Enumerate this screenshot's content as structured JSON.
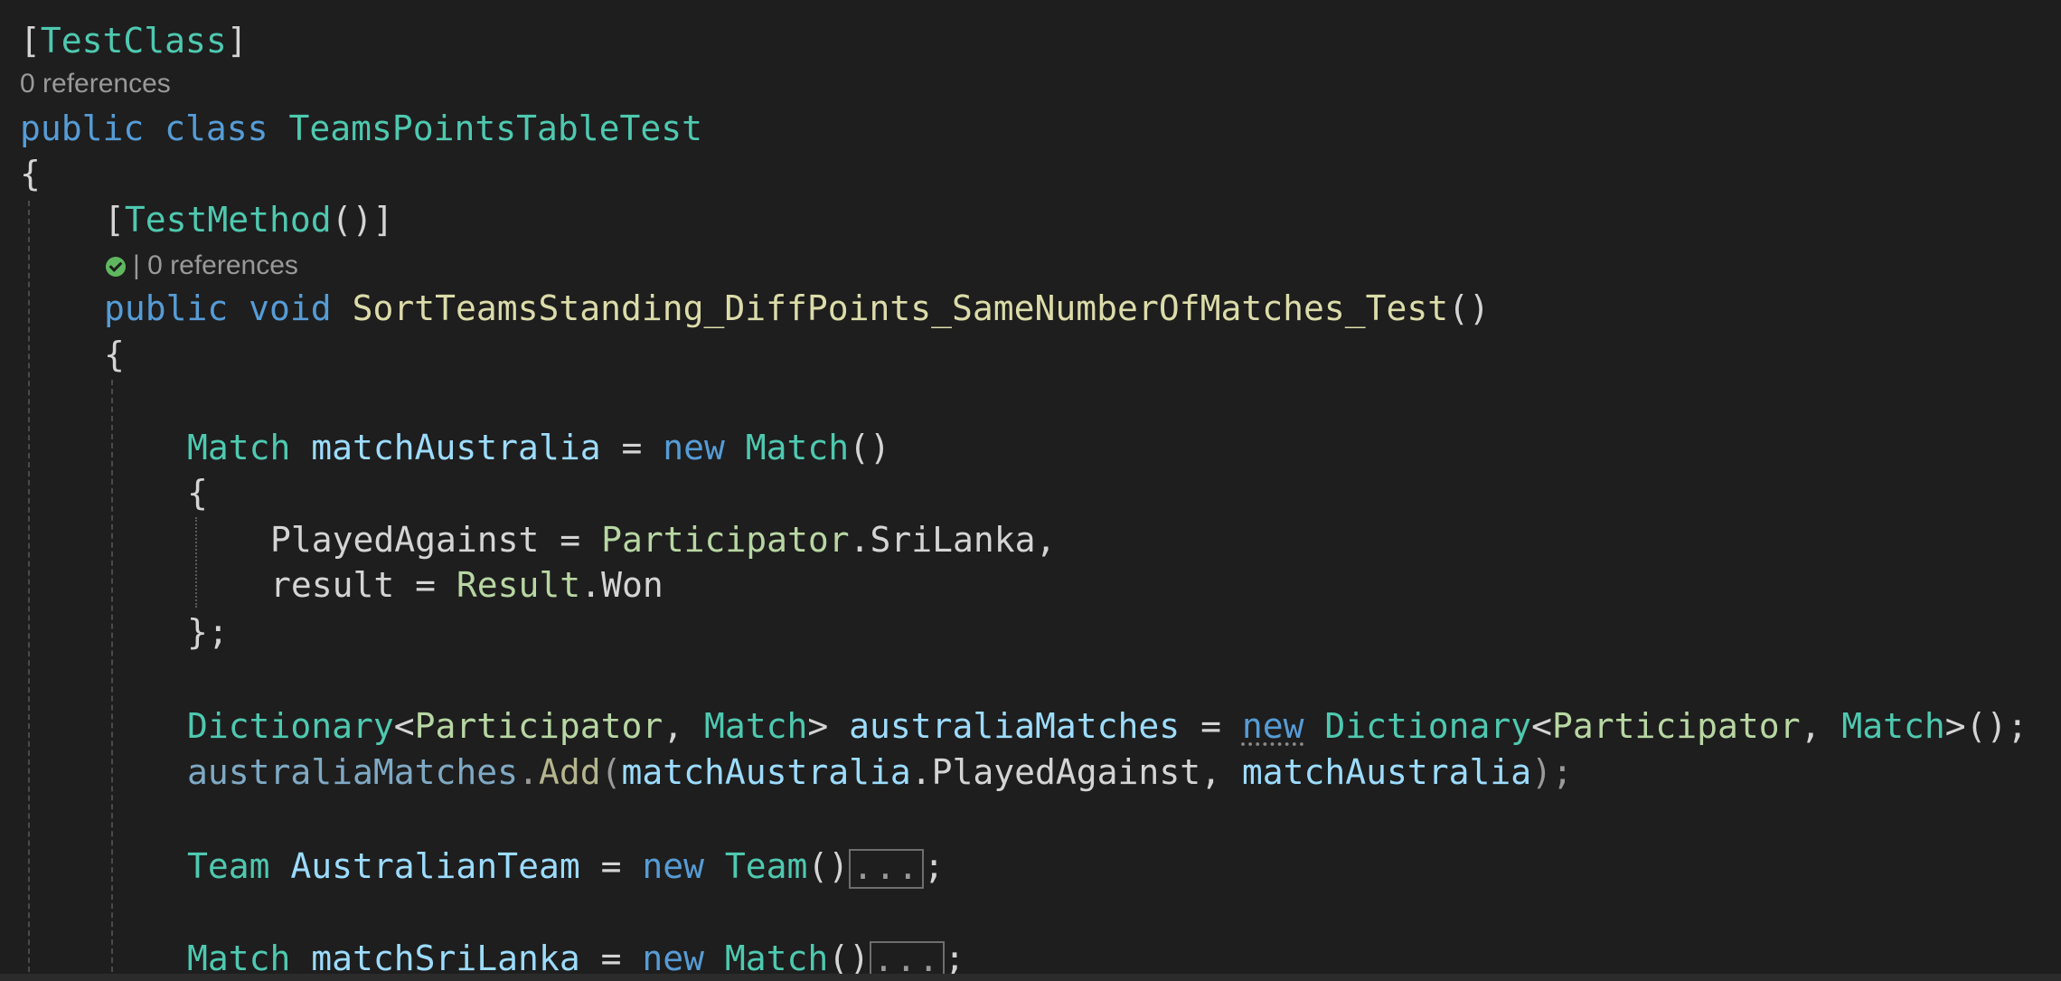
{
  "editor": {
    "attribute_class": "TestClass",
    "refs_class": "0 references",
    "kw_public": "public",
    "kw_class": "class",
    "class_name": "TeamsPointsTableTest",
    "attribute_method": "TestMethod",
    "refs_method": "| 0 references",
    "kw_void": "void",
    "method_name": "SortTeamsStanding_DiffPoints_SameNumberOfMatches_Test",
    "kw_new": "new",
    "type_match": "Match",
    "var_match_australia": "matchAustralia",
    "prop_played_against": "PlayedAgainst",
    "type_participator": "Participator",
    "enum_srilanka": "SriLanka",
    "prop_result": "result",
    "type_result": "Result",
    "enum_won": "Won",
    "type_dictionary": "Dictionary",
    "var_australia_matches": "australiaMatches",
    "method_add": "Add",
    "type_team": "Team",
    "var_australian_team": "AustralianTeam",
    "var_match_srilanka": "matchSriLanka",
    "collapsed_placeholder": "..."
  },
  "colors": {
    "background": "#1e1e1e",
    "keyword": "#569cd6",
    "type": "#4ec9b0",
    "method": "#dcdcaa",
    "variable": "#9cdcfe",
    "plain": "#d4d4d4",
    "codelens": "#999999",
    "test_passed": "#5fb85f"
  }
}
